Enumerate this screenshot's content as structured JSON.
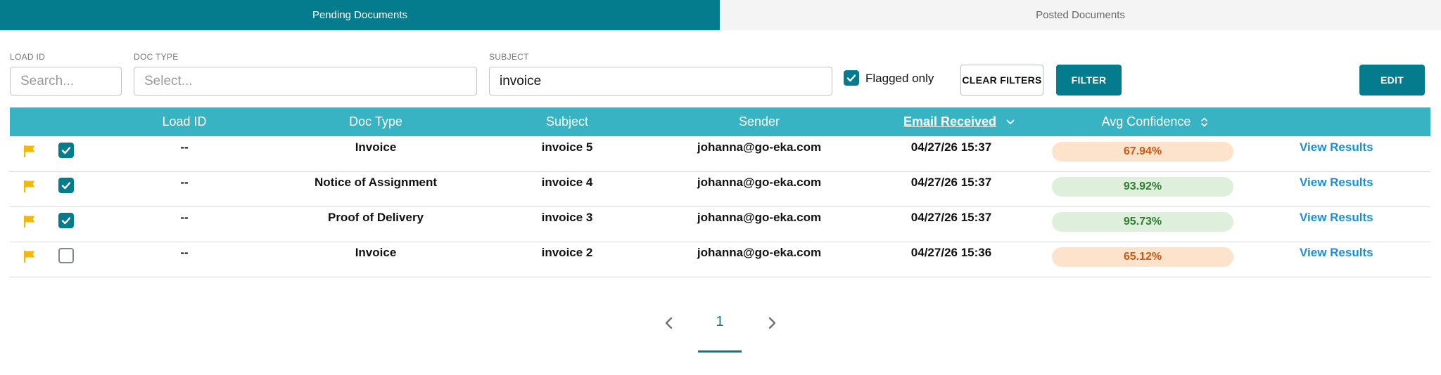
{
  "tabs": [
    {
      "label": "Pending Documents",
      "active": true
    },
    {
      "label": "Posted Documents",
      "active": false
    }
  ],
  "filters": {
    "load_id": {
      "label": "LOAD ID",
      "value": "",
      "placeholder": "Search..."
    },
    "doc_type": {
      "label": "DOC TYPE",
      "value": "",
      "placeholder": "Select..."
    },
    "subject": {
      "label": "SUBJECT",
      "value": "invoice",
      "placeholder": ""
    },
    "flagged_only": {
      "label": "Flagged only",
      "checked": true
    },
    "clear_label": "CLEAR FILTERS",
    "filter_label": "FILTER",
    "edit_label": "EDIT"
  },
  "table": {
    "columns": [
      "Load ID",
      "Doc Type",
      "Subject",
      "Sender",
      "Email Received",
      "Avg Confidence"
    ],
    "sorted_column": "Email Received",
    "rows": [
      {
        "flagged": true,
        "checked": true,
        "load_id": "--",
        "doc_type": "Invoice",
        "subject": "invoice 5",
        "sender": "johanna@go-eka.com",
        "received": "04/27/26 15:37",
        "confidence": "67.94%",
        "level": "low",
        "action": "View Results"
      },
      {
        "flagged": true,
        "checked": true,
        "load_id": "--",
        "doc_type": "Notice of Assignment",
        "subject": "invoice 4",
        "sender": "johanna@go-eka.com",
        "received": "04/27/26 15:37",
        "confidence": "93.92%",
        "level": "high",
        "action": "View Results"
      },
      {
        "flagged": true,
        "checked": true,
        "load_id": "--",
        "doc_type": "Proof of Delivery",
        "subject": "invoice 3",
        "sender": "johanna@go-eka.com",
        "received": "04/27/26 15:37",
        "confidence": "95.73%",
        "level": "high",
        "action": "View Results"
      },
      {
        "flagged": true,
        "checked": false,
        "load_id": "--",
        "doc_type": "Invoice",
        "subject": "invoice 2",
        "sender": "johanna@go-eka.com",
        "received": "04/27/26 15:36",
        "confidence": "65.12%",
        "level": "low",
        "action": "View Results"
      }
    ]
  },
  "pagination": {
    "current_page": "1"
  },
  "colors": {
    "primary": "#047c8e",
    "header": "#38b3c3",
    "flag": "#f2b90c",
    "link": "#1a8fd8",
    "low_bg": "#fde3cc",
    "low_text": "#cc5a13",
    "high_bg": "#def0dc",
    "high_text": "#2f7d32"
  },
  "icons": {
    "row_flag": "flag-icon",
    "checkbox": "check-icon",
    "sort_active": "chevron-down-icon",
    "sort_neutral": "sort-icon",
    "prev": "chevron-left-icon",
    "next": "chevron-right-icon"
  }
}
